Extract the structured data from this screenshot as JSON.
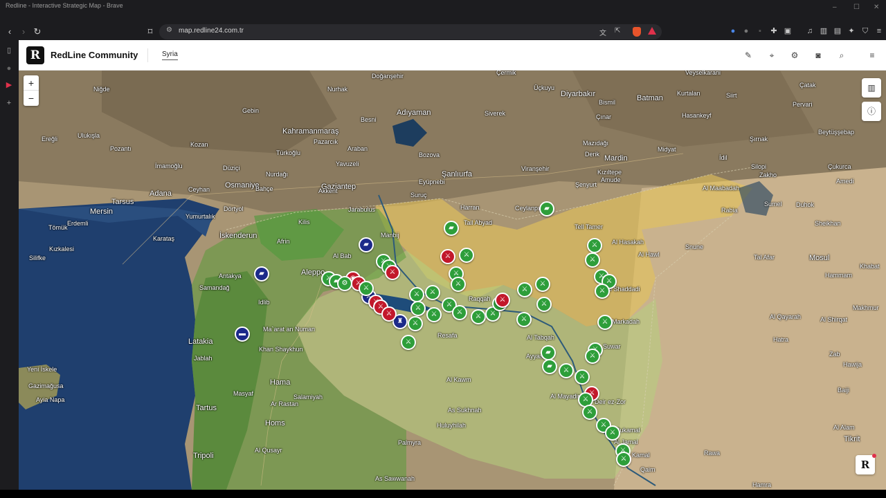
{
  "browser": {
    "window_title": "Redline - Interactive Strategic Map - Brave",
    "url": "map.redline24.com.tr"
  },
  "app": {
    "logo_letter": "R",
    "name": "RedLine Community",
    "tab": "Syria"
  },
  "map": {
    "zoom_in": "+",
    "zoom_out": "−",
    "badge_letter": "R",
    "labels": {
      "cermik": "Çermik",
      "veysel": "Veyselkarani",
      "catak": "Çatak",
      "nigde": "Niğde",
      "nurhak": "Nurhak",
      "dogansehir": "Doğanşehir",
      "uckuyu": "Üçkuyu",
      "diyarbakir": "Diyarbakır",
      "bismil": "Bismil",
      "kurtalan": "Kurtalan",
      "siirt": "Siirt",
      "pervari": "Pervari",
      "batman": "Batman",
      "hasankeyf": "Hasankeyf",
      "gebin": "Gebin",
      "adiyaman": "Adıyaman",
      "siverek": "Siverek",
      "cinar": "Çınar",
      "eregli": "Ereğli",
      "ulukisla": "Ulukışla",
      "kahramanmaras": "Kahramanmaraş",
      "pazarcik": "Pazarcık",
      "besni": "Besni",
      "kozan": "Kozan",
      "pozanti": "Pozantı",
      "turkoglu": "Türkoğlu",
      "araban": "Araban",
      "bozova": "Bozova",
      "derik": "Derik",
      "mazidagi": "Mazıdağı",
      "midyat": "Midyat",
      "sirnak": "Şırnak",
      "beytussebap": "Beytüşşebap",
      "imamoglu": "İmamoğlu",
      "duzici": "Düziçi",
      "yavuzeli": "Yavuzeli",
      "eyupnebi": "Eyüpnebi",
      "sanliurfa": "Şanlıurfa",
      "viransehir": "Viranşehir",
      "mardin": "Mardin",
      "kiziltepe": "Kızıltepe",
      "idil": "İdil",
      "silopi": "Silopi",
      "cukurca": "Çukurca",
      "adana": "Adana",
      "osmaniye": "Osmaniye",
      "nurdagi": "Nurdağı",
      "gaziantep": "Gaziantep",
      "semyun": "Şenyurt",
      "amude": "Amude",
      "zakho": "Zakho",
      "amedi": "Amedi",
      "ceyhan": "Ceyhan",
      "bahce": "Bahçe",
      "akkent": "Akkent",
      "suruc": "Suruç",
      "ceylanpinar": "Ceylanpınar",
      "almaabadah": "Al Maabadah",
      "tarsus": "Tarsus",
      "mersin": "Mersin",
      "yumurtalik": "Yumurtalık",
      "kilis": "Kilis",
      "jarabulus": "Jarabulus",
      "harran": "Harran",
      "tallabyad": "Tall Abyad",
      "tallamer": "Tell Tamer",
      "rabia": "Rabia",
      "sumel": "Sumel",
      "duhok": "Duhok",
      "sheikhan": "Sheikhan",
      "tomuk": "Tömük",
      "erdemli": "Erdemli",
      "dortyol": "Dörtyol",
      "iskenderun": "İskenderun",
      "afrin": "Afrin",
      "manbij": "Manbij",
      "alhasakah": "Al Hasakah",
      "alhawl": "Al Hawl",
      "sinune": "Snune",
      "talafar": "Tal Afar",
      "mosul": "Mosul",
      "kizkalesi": "Kızkalesi",
      "karatas": "Karataş",
      "silifke": "Silifke",
      "antakya": "Antakya",
      "aleppo": "Aleppo",
      "albab": "Al Bab",
      "samandag": "Samandağ",
      "idlib": "Idlib",
      "alshaddadi": "Al Shaddadi",
      "raqqah": "Raqqah",
      "khabat": "Khabat",
      "hammam": "Hammam",
      "maarat": "Ma`arat an Numan",
      "resafa": "Resafa",
      "altabqah": "Al Tabqah",
      "suwar": "Suwar",
      "markadah": "Markadah",
      "aljayarah": "Al Qayarah",
      "alshirqat": "Al Shirqat",
      "makhmur": "Makhmur",
      "latakia": "Latakia",
      "jablah": "Jablah",
      "hatra": "Hatra",
      "zaxo": "Zab",
      "yeniiskele": "Yeni İskele",
      "gazimagusa": "Gazimağusa",
      "ayianapa": "Ayia Napa",
      "khanshaykhun": "Khan Shaykhun",
      "alkawm": "Al Kawm",
      "almayadin": "Al Mayadin",
      "hawija": "Hawija",
      "hama": "Hama",
      "salamiyah": "Salamiyah",
      "ayyash": "Ayyash",
      "deirezzor": "Deir ez-Zor",
      "baiji": "Baiji",
      "tartus": "Tartus",
      "masyaf": "Masyaf",
      "homs": "Homs",
      "arrastan": "Ar Rastan",
      "assukhnah": "As Sukhnah",
      "hulayhilah": "Huluyhilah",
      "albukamal": "Al Bukamal",
      "alalam": "Al Alam",
      "tikrit": "Tikrit",
      "tripoli": "Tripoli",
      "alqusayr": "Al Qusayr",
      "palmyra": "Palmyra",
      "aljamal": "Al Jamal",
      "rawa": "Rawa",
      "kamal": "Kamal",
      "qaim": "Qaim",
      "assawwanah": "As Sawwanah",
      "hamra": "Hamra"
    }
  }
}
